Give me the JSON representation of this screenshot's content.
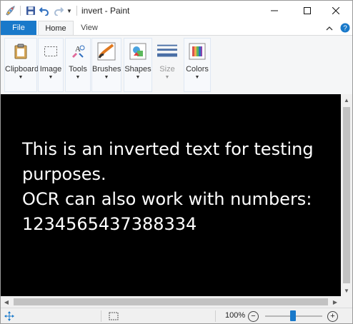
{
  "window": {
    "title": "invert - Paint"
  },
  "titlebar": {
    "quick_access_icons": [
      "paint-app-icon",
      "save-icon",
      "undo-icon",
      "redo-icon",
      "customize-dropdown-icon"
    ]
  },
  "tabs": [
    {
      "label": "File"
    },
    {
      "label": "Home"
    },
    {
      "label": "View"
    }
  ],
  "ribbon": {
    "groups": [
      {
        "label": "Clipboard",
        "icon": "clipboard-icon"
      },
      {
        "label": "Image",
        "icon": "select-icon"
      },
      {
        "label": "Tools",
        "icon": "tools-icon"
      },
      {
        "label": "Brushes",
        "icon": "brush-icon"
      },
      {
        "label": "Shapes",
        "icon": "shapes-icon"
      },
      {
        "label": "Size",
        "icon": "size-icon",
        "disabled": true
      },
      {
        "label": "Colors",
        "icon": "color-palette-icon"
      }
    ]
  },
  "canvas": {
    "lines": [
      "This is an inverted text for testing",
      "purposes.",
      "OCR can also work with numbers:",
      "1234565437388334"
    ],
    "background": "#000000",
    "text_color": "#ffffff"
  },
  "statusbar": {
    "zoom": "100%",
    "zoom_out": "−",
    "zoom_in": "+",
    "zoom_slider_fraction": 0.5
  },
  "colors": {
    "accent": "#1979ca"
  }
}
